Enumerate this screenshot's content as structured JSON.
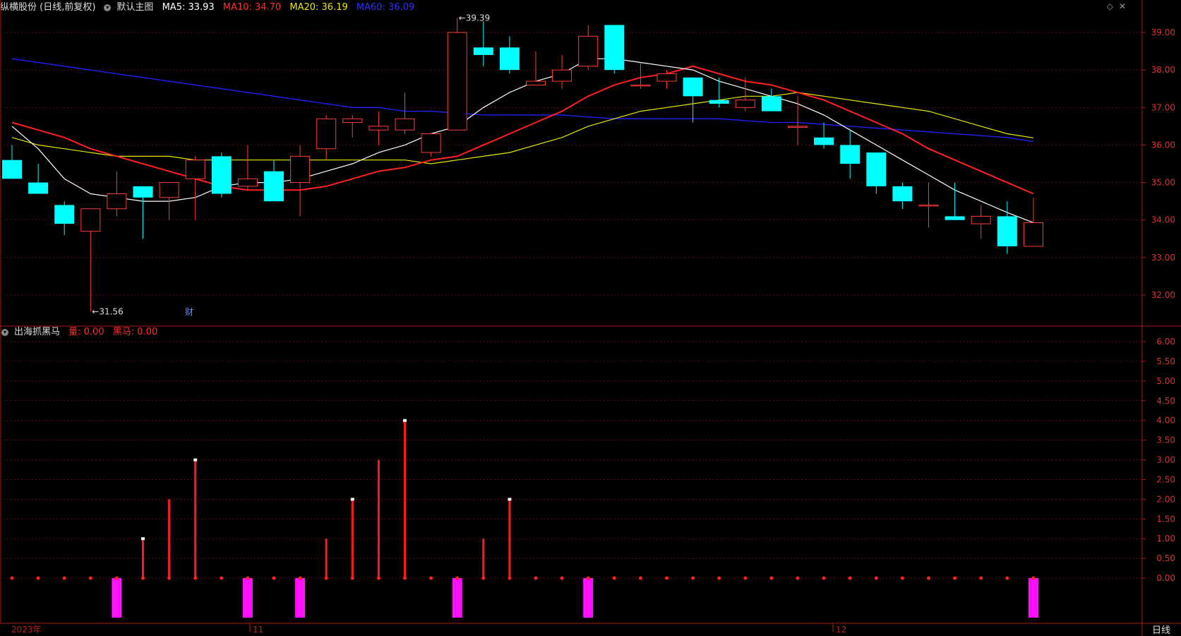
{
  "header": {
    "stock_title": "纵横股份 (日线,前复权)",
    "main_indicator": "默认主图",
    "ma5_label": "MA5: 33.93",
    "ma10_label": "MA10: 34.70",
    "ma20_label": "MA20: 36.19",
    "ma60_label": "MA60: 36.09",
    "colors": {
      "ma5": "#ffffff",
      "ma10": "#ff2020",
      "ma20": "#e8e800",
      "ma60": "#2222ff"
    }
  },
  "sub_header": {
    "indicator_name": "出海抓黑马",
    "vol_label": "量: 0.00",
    "horse_label": "黑马: 0.00"
  },
  "right_icons": [
    "diamond-icon",
    "close-icon"
  ],
  "period_label": "日线",
  "fin_marker": "财",
  "chart_data": [
    {
      "type": "candlestick",
      "ylim": [
        31.5,
        39.5
      ],
      "y_ticks": [
        "39.00",
        "38.00",
        "37.00",
        "36.00",
        "35.00",
        "34.00",
        "33.00",
        "32.00"
      ],
      "x_labels": [
        "2023年",
        "11",
        "12"
      ],
      "annotations": [
        {
          "text": "39.39",
          "index": 17,
          "value": 39.39
        },
        {
          "text": "31.56",
          "index": 3,
          "value": 31.56
        }
      ],
      "candles": [
        {
          "o": 35.6,
          "h": 36.0,
          "l": 35.1,
          "c": 35.1
        },
        {
          "o": 35.0,
          "h": 35.5,
          "l": 34.7,
          "c": 34.7
        },
        {
          "o": 34.4,
          "h": 34.5,
          "l": 33.6,
          "c": 33.9
        },
        {
          "o": 33.7,
          "h": 34.3,
          "l": 31.56,
          "c": 34.3
        },
        {
          "o": 34.3,
          "h": 35.3,
          "l": 34.1,
          "c": 34.7
        },
        {
          "o": 34.9,
          "h": 34.9,
          "l": 33.5,
          "c": 34.6
        },
        {
          "o": 34.6,
          "h": 35.0,
          "l": 34.0,
          "c": 35.0
        },
        {
          "o": 35.1,
          "h": 35.7,
          "l": 34.0,
          "c": 35.6
        },
        {
          "o": 35.7,
          "h": 35.8,
          "l": 34.6,
          "c": 34.7
        },
        {
          "o": 34.9,
          "h": 36.0,
          "l": 34.8,
          "c": 35.1
        },
        {
          "o": 35.3,
          "h": 35.6,
          "l": 34.5,
          "c": 34.5
        },
        {
          "o": 35.0,
          "h": 36.0,
          "l": 34.1,
          "c": 35.7
        },
        {
          "o": 35.9,
          "h": 36.8,
          "l": 35.6,
          "c": 36.7
        },
        {
          "o": 36.6,
          "h": 36.8,
          "l": 36.2,
          "c": 36.7
        },
        {
          "o": 36.4,
          "h": 36.9,
          "l": 36.0,
          "c": 36.5
        },
        {
          "o": 36.4,
          "h": 37.4,
          "l": 36.3,
          "c": 36.7
        },
        {
          "o": 35.8,
          "h": 36.3,
          "l": 35.7,
          "c": 36.3
        },
        {
          "o": 36.4,
          "h": 39.39,
          "l": 36.4,
          "c": 39.0
        },
        {
          "o": 38.6,
          "h": 39.3,
          "l": 38.1,
          "c": 38.4
        },
        {
          "o": 38.6,
          "h": 38.9,
          "l": 37.9,
          "c": 38.0
        },
        {
          "o": 37.6,
          "h": 38.5,
          "l": 37.6,
          "c": 37.7
        },
        {
          "o": 37.7,
          "h": 38.4,
          "l": 37.5,
          "c": 38.0
        },
        {
          "o": 38.1,
          "h": 39.2,
          "l": 38.0,
          "c": 38.9
        },
        {
          "o": 39.2,
          "h": 39.2,
          "l": 37.9,
          "c": 38.0
        },
        {
          "o": 37.6,
          "h": 38.2,
          "l": 37.5,
          "c": 37.6
        },
        {
          "o": 37.7,
          "h": 38.0,
          "l": 37.5,
          "c": 37.9
        },
        {
          "o": 37.8,
          "h": 37.8,
          "l": 36.6,
          "c": 37.3
        },
        {
          "o": 37.2,
          "h": 37.8,
          "l": 37.0,
          "c": 37.1
        },
        {
          "o": 37.0,
          "h": 37.8,
          "l": 36.9,
          "c": 37.2
        },
        {
          "o": 37.3,
          "h": 37.5,
          "l": 36.9,
          "c": 36.9
        },
        {
          "o": 36.5,
          "h": 37.3,
          "l": 36.0,
          "c": 36.5
        },
        {
          "o": 36.2,
          "h": 36.6,
          "l": 35.9,
          "c": 36.0
        },
        {
          "o": 36.0,
          "h": 36.4,
          "l": 35.1,
          "c": 35.5
        },
        {
          "o": 35.8,
          "h": 35.8,
          "l": 34.7,
          "c": 34.9
        },
        {
          "o": 34.9,
          "h": 35.0,
          "l": 34.3,
          "c": 34.5
        },
        {
          "o": 34.4,
          "h": 35.0,
          "l": 33.8,
          "c": 34.4
        },
        {
          "o": 34.1,
          "h": 35.0,
          "l": 34.0,
          "c": 34.0
        },
        {
          "o": 33.9,
          "h": 34.4,
          "l": 33.5,
          "c": 34.1
        },
        {
          "o": 34.1,
          "h": 34.5,
          "l": 33.1,
          "c": 33.3
        },
        {
          "o": 33.3,
          "h": 34.6,
          "l": 33.3,
          "c": 33.93
        }
      ],
      "ma5": [
        36.5,
        35.9,
        35.1,
        34.7,
        34.6,
        34.5,
        34.5,
        34.6,
        34.9,
        35.0,
        35.0,
        35.1,
        35.3,
        35.5,
        35.8,
        36.0,
        36.3,
        36.5,
        37.0,
        37.4,
        37.7,
        37.9,
        38.3,
        38.3,
        38.2,
        38.1,
        38.0,
        37.7,
        37.5,
        37.3,
        37.1,
        36.8,
        36.4,
        36.0,
        35.6,
        35.2,
        34.8,
        34.5,
        34.2,
        33.93
      ],
      "ma10": [
        36.6,
        36.4,
        36.2,
        35.9,
        35.7,
        35.5,
        35.3,
        35.1,
        34.9,
        34.8,
        34.8,
        34.8,
        34.9,
        35.1,
        35.3,
        35.4,
        35.6,
        35.7,
        36.0,
        36.3,
        36.6,
        36.9,
        37.3,
        37.6,
        37.8,
        37.9,
        38.1,
        37.9,
        37.7,
        37.6,
        37.4,
        37.2,
        36.9,
        36.6,
        36.3,
        35.9,
        35.6,
        35.3,
        35.0,
        34.7
      ],
      "ma20": [
        36.2,
        36.0,
        35.9,
        35.8,
        35.7,
        35.7,
        35.7,
        35.6,
        35.6,
        35.6,
        35.6,
        35.6,
        35.6,
        35.6,
        35.6,
        35.6,
        35.5,
        35.6,
        35.7,
        35.8,
        36.0,
        36.2,
        36.5,
        36.7,
        36.9,
        37.0,
        37.1,
        37.2,
        37.3,
        37.3,
        37.4,
        37.3,
        37.2,
        37.1,
        37.0,
        36.9,
        36.7,
        36.5,
        36.3,
        36.19
      ],
      "ma60": [
        38.3,
        38.2,
        38.1,
        38.0,
        37.9,
        37.8,
        37.7,
        37.6,
        37.5,
        37.4,
        37.3,
        37.2,
        37.1,
        37.0,
        37.0,
        36.9,
        36.9,
        36.85,
        36.8,
        36.8,
        36.8,
        36.8,
        36.75,
        36.7,
        36.7,
        36.7,
        36.7,
        36.7,
        36.65,
        36.6,
        36.6,
        36.55,
        36.5,
        36.45,
        36.4,
        36.35,
        36.3,
        36.25,
        36.2,
        36.09
      ]
    },
    {
      "type": "bar",
      "ylim": [
        -1.0,
        6.3
      ],
      "y_ticks": [
        "6.00",
        "5.50",
        "5.00",
        "4.50",
        "4.00",
        "3.50",
        "3.00",
        "2.50",
        "2.00",
        "1.50",
        "1.00",
        "0.50",
        "0.00"
      ],
      "series": [
        {
          "name": "量",
          "values": [
            0,
            0,
            0,
            0,
            0,
            1,
            2,
            3,
            0,
            0,
            0,
            0,
            1,
            2,
            3,
            4,
            0,
            0,
            1,
            2,
            0,
            0,
            0,
            0,
            0,
            0,
            0,
            0,
            0,
            0,
            0,
            0,
            0,
            0,
            0,
            0,
            0,
            0,
            0,
            0
          ]
        },
        {
          "name": "黑马",
          "values": [
            0,
            0,
            0,
            0,
            1,
            0,
            0,
            0,
            0,
            1,
            0,
            1,
            0,
            0,
            0,
            0,
            0,
            1,
            0,
            0,
            0,
            0,
            1,
            0,
            0,
            0,
            0,
            0,
            0,
            0,
            0,
            0,
            0,
            0,
            0,
            0,
            0,
            0,
            0,
            1
          ]
        }
      ],
      "white_tips": [
        5,
        7,
        13,
        15,
        19
      ]
    }
  ]
}
